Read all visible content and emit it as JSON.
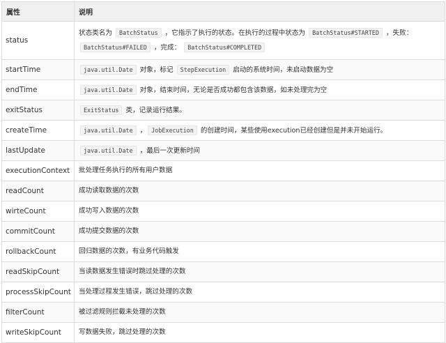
{
  "header": {
    "attr": "属性",
    "desc": "说明"
  },
  "rows": [
    {
      "name": "status",
      "desc": [
        {
          "t": "状态类名为 "
        },
        {
          "c": "BatchStatus"
        },
        {
          "t": " ，它指示了执行的状态。在执行的过程中状态为 "
        },
        {
          "c": "BatchStatus#STARTED"
        },
        {
          "t": " ，失败："
        },
        {
          "c": "BatchStatus#FAILED"
        },
        {
          "t": " ，完成： "
        },
        {
          "c": "BatchStatus#COMPLETED"
        }
      ]
    },
    {
      "name": "startTime",
      "desc": [
        {
          "c": "java.util.Date"
        },
        {
          "t": " 对象，标记 "
        },
        {
          "c": "StepExecution"
        },
        {
          "t": " 启动的系统时间，未启动数据为空"
        }
      ]
    },
    {
      "name": "endTime",
      "desc": [
        {
          "c": "java.util.Date"
        },
        {
          "t": " 对象，结束时间，无论是否成功都包含该数据，如未处理完为空"
        }
      ]
    },
    {
      "name": "exitStatus",
      "desc": [
        {
          "c": "ExitStatus"
        },
        {
          "t": " 类，记录运行结果。"
        }
      ]
    },
    {
      "name": "createTime",
      "desc": [
        {
          "c": "java.util.Date"
        },
        {
          "t": " ，"
        },
        {
          "c": "JobExecution"
        },
        {
          "t": " 的创建时间，某些使用execution已经创建但是并未开始运行。"
        }
      ]
    },
    {
      "name": "lastUpdate",
      "desc": [
        {
          "c": "java.util.Date"
        },
        {
          "t": " ，最后一次更新时间"
        }
      ]
    },
    {
      "name": "executionContext",
      "desc": [
        {
          "t": "批处理任务执行的所有用户数据"
        }
      ]
    },
    {
      "name": "readCount",
      "desc": [
        {
          "t": "成功读取数据的次数"
        }
      ]
    },
    {
      "name": "wirteCount",
      "desc": [
        {
          "t": "成功写入数据的次数"
        }
      ]
    },
    {
      "name": "commitCount",
      "desc": [
        {
          "t": "成功提交数据的次数"
        }
      ]
    },
    {
      "name": "rollbackCount",
      "desc": [
        {
          "t": "回归数据的次数，有业务代码触发"
        }
      ]
    },
    {
      "name": "readSkipCount",
      "desc": [
        {
          "t": "当读数据发生错误时跳过处理的次数"
        }
      ]
    },
    {
      "name": "processSkipCount",
      "desc": [
        {
          "t": "当处理过程发生错误，跳过处理的次数"
        }
      ]
    },
    {
      "name": "filterCount",
      "desc": [
        {
          "t": "被过滤规则拦截未处理的次数"
        }
      ]
    },
    {
      "name": "writeSkipCount",
      "desc": [
        {
          "t": "写数据失败，跳过处理的次数"
        }
      ]
    }
  ]
}
